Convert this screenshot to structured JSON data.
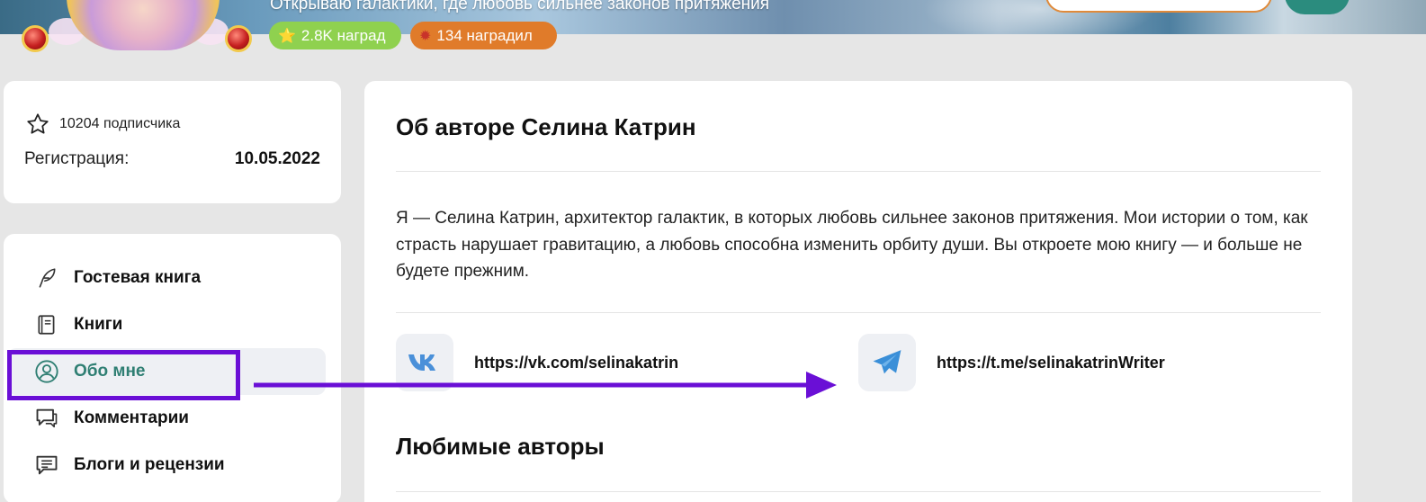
{
  "header": {
    "slogan": "Открываю галактики, где любовь сильнее законов притяжения",
    "awards_badge": "2.8K наград",
    "awarded_badge": "134 наградил"
  },
  "stats": {
    "subscribers": "10204 подписчика",
    "registration_label": "Регистрация:",
    "registration_date": "10.05.2022"
  },
  "nav": {
    "items": [
      {
        "label": "Гостевая книга",
        "icon": "quill-icon"
      },
      {
        "label": "Книги",
        "icon": "book-icon"
      },
      {
        "label": "Обо мне",
        "icon": "user-icon",
        "active": true
      },
      {
        "label": "Комментарии",
        "icon": "comments-icon"
      },
      {
        "label": "Блоги и рецензии",
        "icon": "blog-icon"
      }
    ]
  },
  "about": {
    "title": "Об авторе Селина Катрин",
    "bio": "Я — Селина Катрин, архитектор галактик, в которых любовь сильнее законов притяжения. Мои истории о том, как страсть нарушает гравитацию, а любовь способна изменить орбиту души. Вы откроете мою книгу — и больше не будете прежним.",
    "links": [
      {
        "icon": "vk-icon",
        "url": "https://vk.com/selinakatrin"
      },
      {
        "icon": "telegram-icon",
        "url": "https://t.me/selinakatrinWriter"
      }
    ],
    "favorites_title": "Любимые авторы"
  },
  "colors": {
    "accent_teal": "#2f7f73",
    "highlight_purple": "#6a0fd6",
    "awards_green": "#8fd14f",
    "awarded_orange": "#e07b2a",
    "vk_blue": "#4a90d9",
    "telegram_blue": "#3a8fd8"
  }
}
